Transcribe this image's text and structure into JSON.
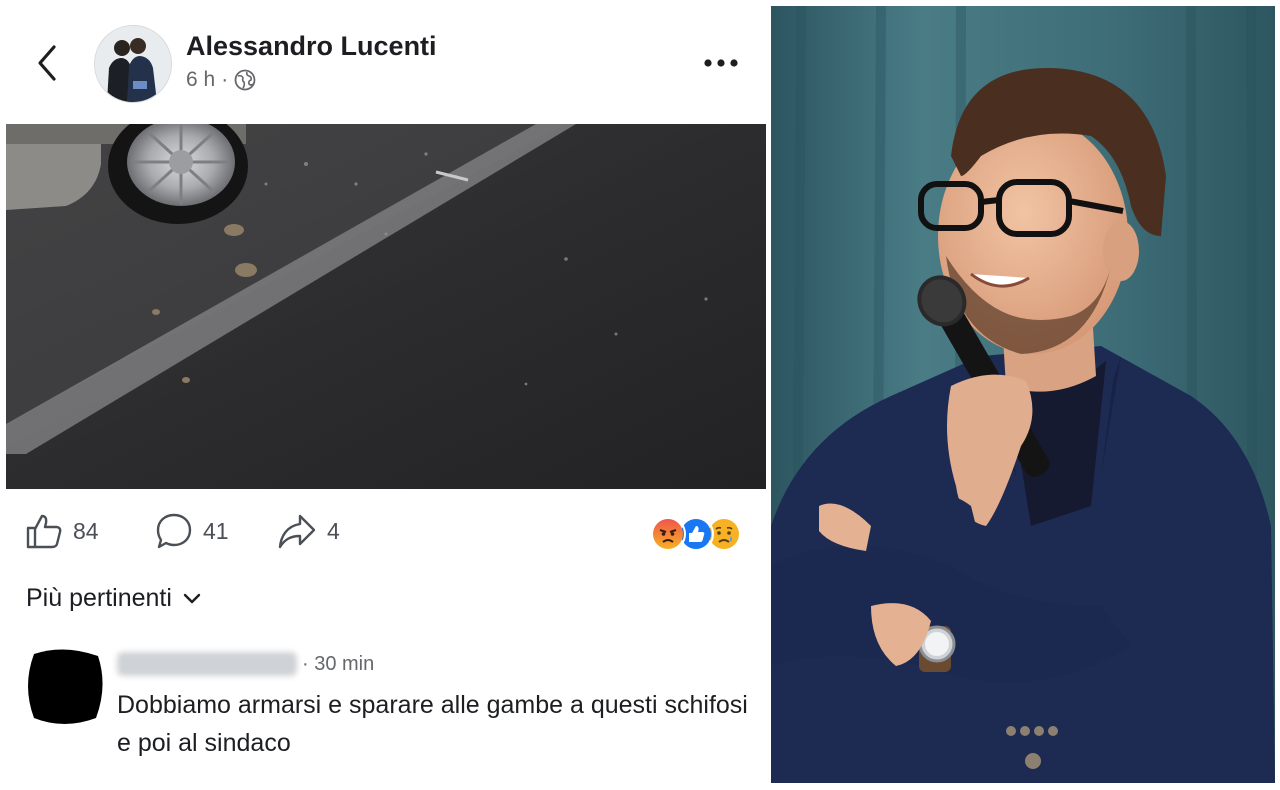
{
  "post": {
    "author": "Alessandro Lucenti",
    "time": "6 h",
    "separator": "·",
    "audience_icon": "globe-icon"
  },
  "actions": {
    "likes": "84",
    "comments": "41",
    "shares": "4"
  },
  "reactions": [
    "angry-reaction-icon",
    "like-reaction-icon",
    "sad-reaction-icon"
  ],
  "sort": {
    "label": "Più pertinenti"
  },
  "comment": {
    "time": "30 min",
    "text": "Dobbiamo armarsi e sparare alle gambe a questi schifosi e poi al sindaco"
  },
  "colors": {
    "facebook_blue": "#1877f2",
    "text_primary": "#1c1e21",
    "text_secondary": "#65676b",
    "angry": "#f0554a",
    "sad": "#f7b125",
    "curtain": "#3f6f7a",
    "jacket": "#1d2a52"
  }
}
